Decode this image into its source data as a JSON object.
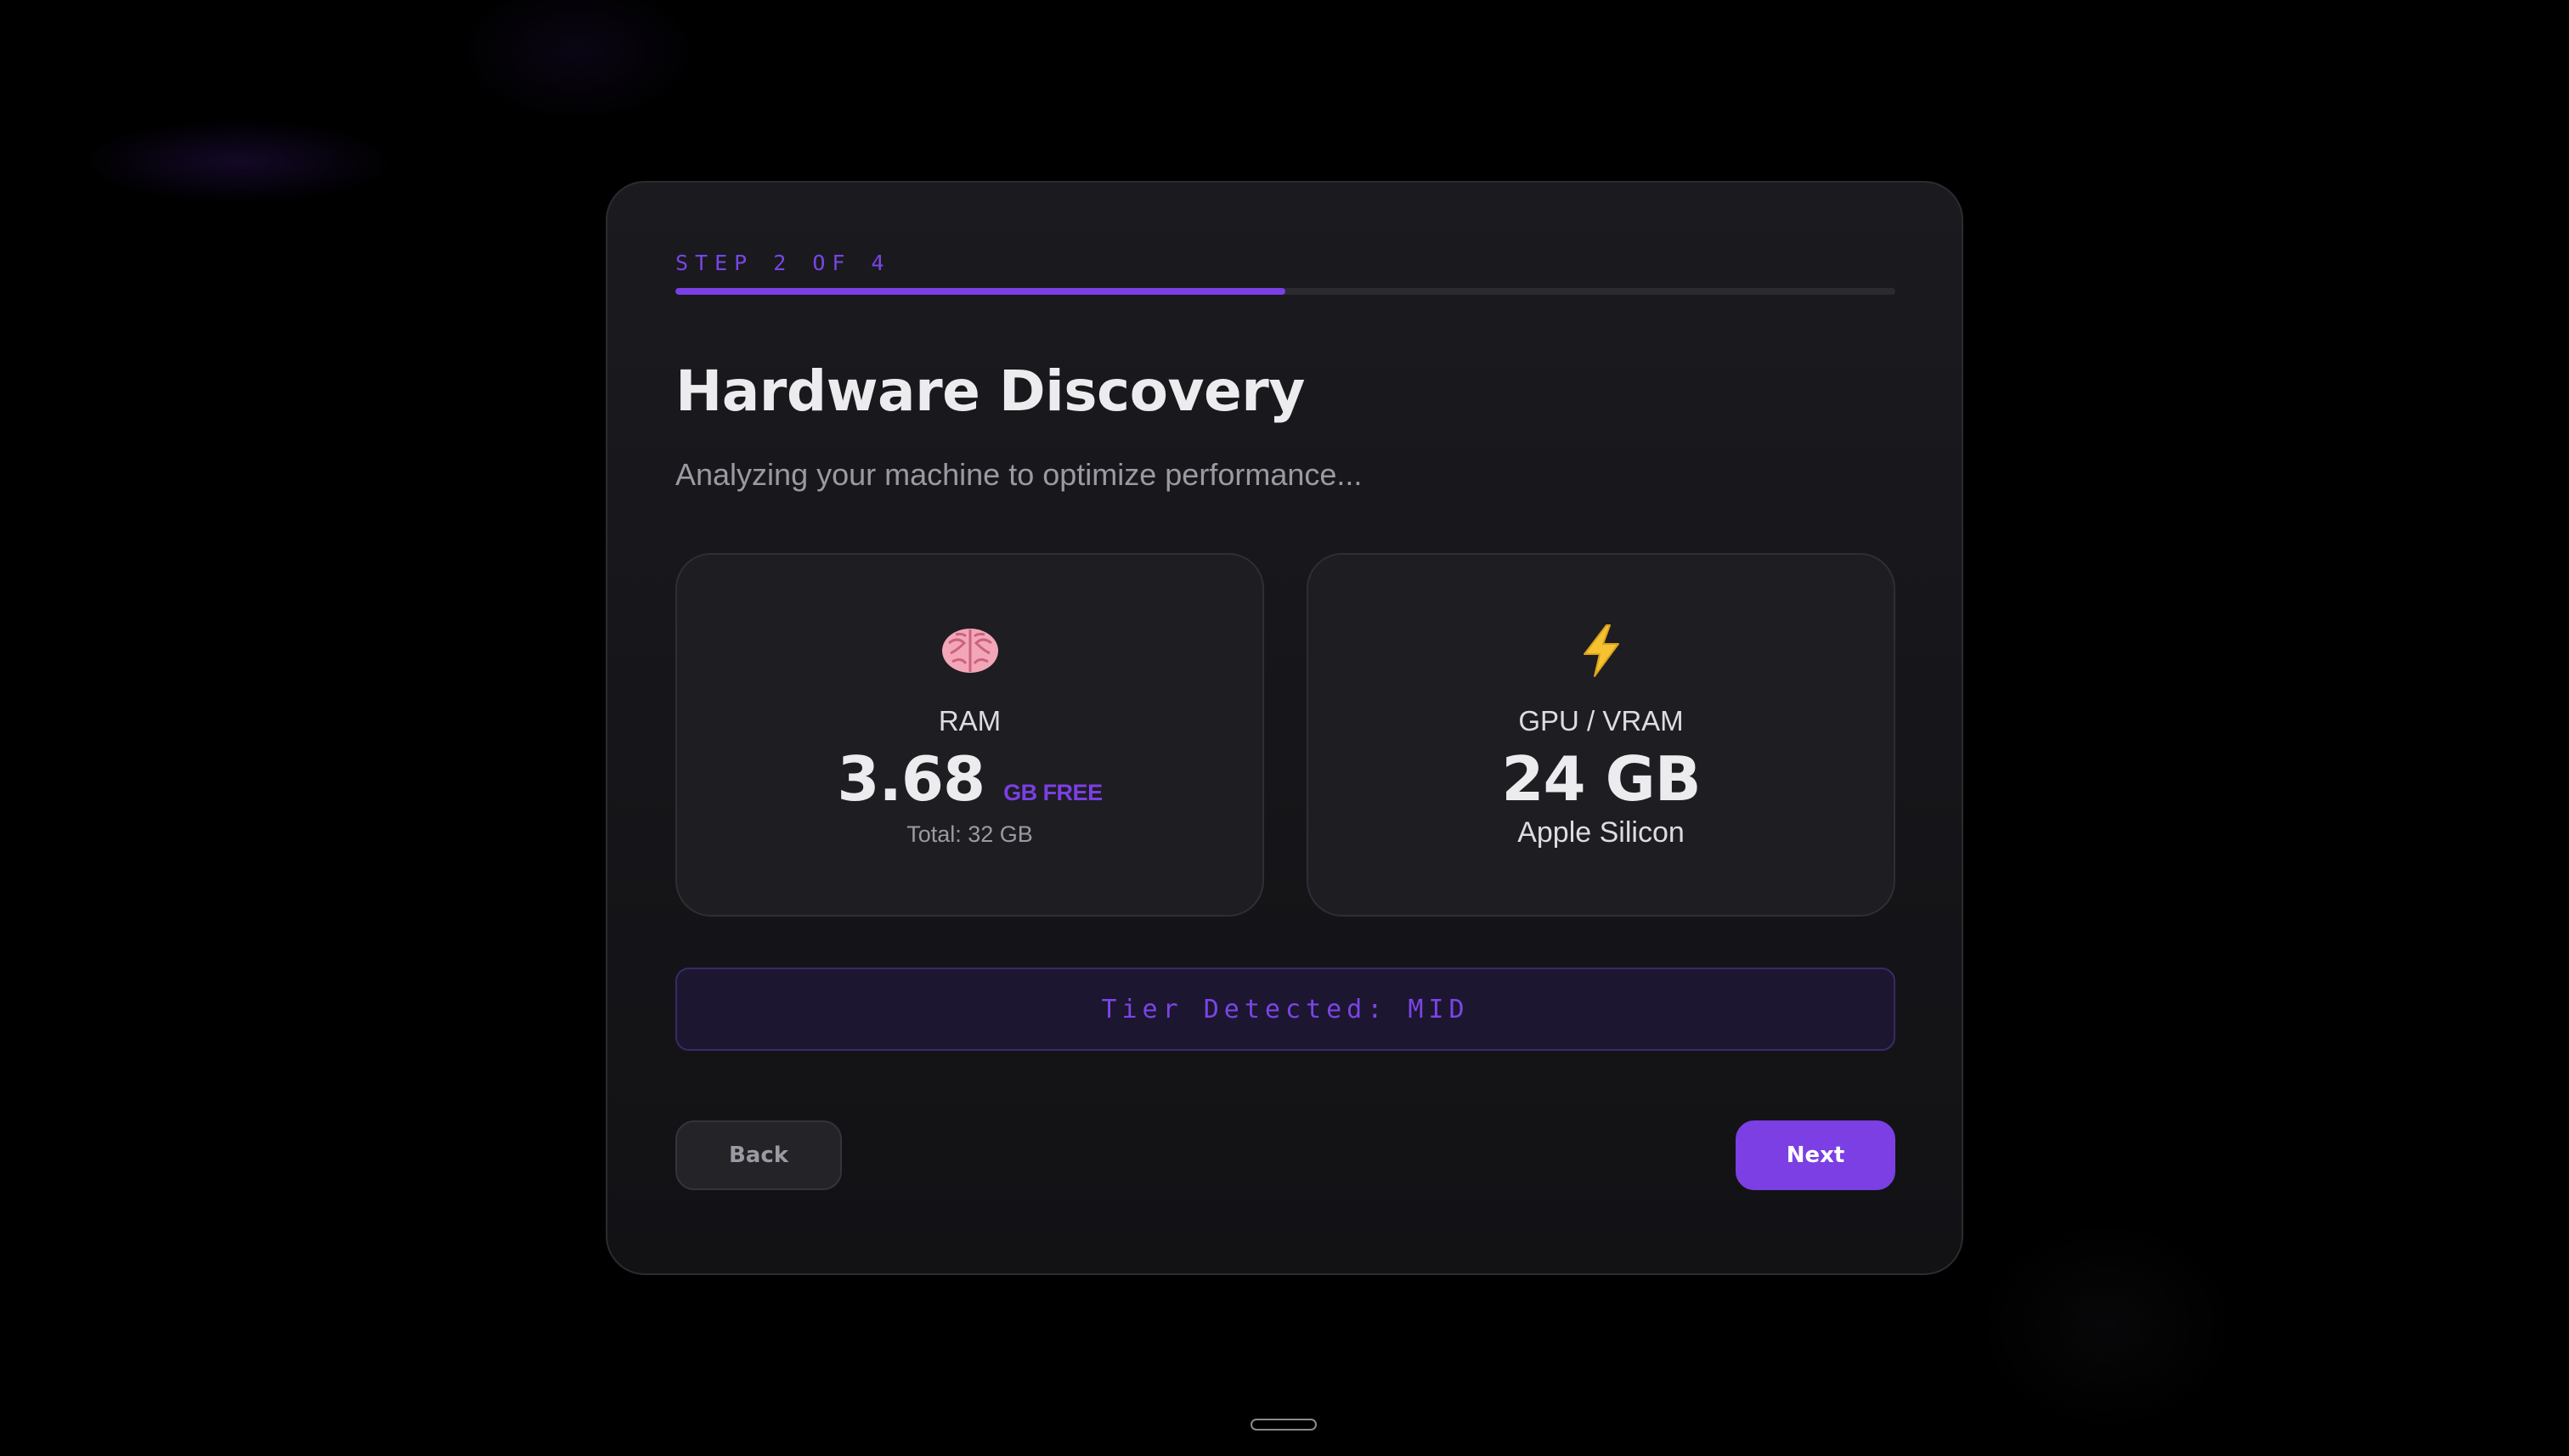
{
  "wizard": {
    "step_label": "STEP 2 OF 4",
    "progress_fraction": 0.5,
    "title": "Hardware Discovery",
    "subtitle": "Analyzing your machine to optimize performance..."
  },
  "cards": {
    "ram": {
      "icon": "brain-icon",
      "label": "RAM",
      "value": "3.68",
      "unit": "GB FREE",
      "sub": "Total: 32 GB"
    },
    "gpu": {
      "icon": "lightning-bolt-icon",
      "label": "GPU / VRAM",
      "value": "24 GB",
      "sub": "Apple Silicon"
    }
  },
  "tier": {
    "text": "Tier Detected: MID"
  },
  "actions": {
    "back_label": "Back",
    "next_label": "Next"
  },
  "colors": {
    "accent": "#7b3fe4",
    "background": "#000000",
    "panel": "#16161a"
  }
}
